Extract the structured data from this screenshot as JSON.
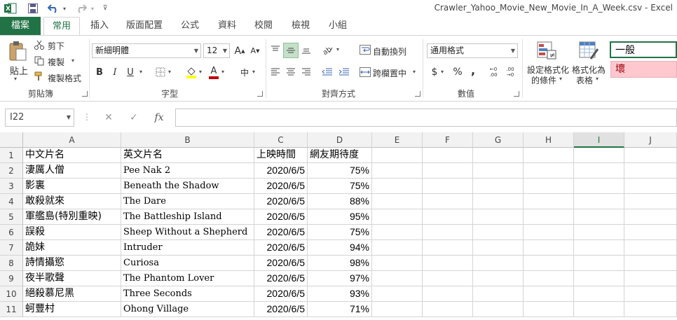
{
  "window": {
    "title": "Crawler_Yahoo_Movie_New_Movie_In_A_Week.csv - Excel"
  },
  "qat": {
    "excel_icon": "excel-logo-icon",
    "save_icon": "save-icon",
    "undo_icon": "undo-icon",
    "redo_icon": "redo-icon",
    "customize_icon": "customize-qat-icon"
  },
  "tabs": {
    "file": "檔案",
    "items": [
      "常用",
      "插入",
      "版面配置",
      "公式",
      "資料",
      "校閱",
      "檢視",
      "小組"
    ]
  },
  "ribbon": {
    "clipboard": {
      "paste": "貼上",
      "cut": "剪下",
      "copy": "複製",
      "format_painter": "複製格式",
      "label": "剪貼簿"
    },
    "font": {
      "name": "新細明體",
      "size": "12",
      "grow": "A",
      "shrink": "A",
      "bold": "B",
      "italic": "I",
      "underline": "U",
      "font_color_letter": "A",
      "phonetic": "中",
      "label": "字型"
    },
    "alignment": {
      "wrap": "自動換列",
      "merge": "跨欄置中",
      "label": "對齊方式"
    },
    "number": {
      "format": "通用格式",
      "currency": "$",
      "percent": "%",
      "comma": ",",
      "inc_decimal": "←0 .00",
      "dec_decimal": ".00 →0",
      "label": "數值"
    },
    "styles": {
      "conditional_line1": "設定格式化",
      "conditional_line2": "的條件",
      "table_line1": "格式化為",
      "table_line2": "表格",
      "normal": "一般",
      "bad": "壞"
    }
  },
  "formula_bar": {
    "name_box": "I22",
    "cancel": "✕",
    "enter": "✓",
    "fx": "fx",
    "value": ""
  },
  "sheet": {
    "columns": [
      "A",
      "B",
      "C",
      "D",
      "E",
      "F",
      "G",
      "H",
      "I",
      "J"
    ],
    "selected_column": "I",
    "row_numbers": [
      "1",
      "2",
      "3",
      "4",
      "5",
      "6",
      "7",
      "8",
      "9",
      "10",
      "11"
    ],
    "rows": [
      [
        "中文片名",
        "英文片名",
        "上映時間",
        "網友期待度"
      ],
      [
        "淒厲人僧",
        "Pee Nak 2",
        "2020/6/5",
        "75%"
      ],
      [
        "影裏",
        "Beneath the Shadow",
        "2020/6/5",
        "75%"
      ],
      [
        "敢殺就來",
        "The Dare",
        "2020/6/5",
        "88%"
      ],
      [
        "軍艦島(特別重映)",
        "The Battleship Island",
        "2020/6/5",
        "95%"
      ],
      [
        "誤殺",
        "Sheep Without a Shepherd",
        "2020/6/5",
        "75%"
      ],
      [
        "詭妹",
        "Intruder",
        "2020/6/5",
        "94%"
      ],
      [
        "詩情攝慾",
        "Curiosa",
        "2020/6/5",
        "98%"
      ],
      [
        "夜半歌聲",
        "The Phantom Lover",
        "2020/6/5",
        "97%"
      ],
      [
        "絕殺慕尼黑",
        "Three Seconds",
        "2020/6/5",
        "93%"
      ],
      [
        "蚵豐村",
        "Ohong Village",
        "2020/6/5",
        "71%"
      ]
    ]
  },
  "colors": {
    "brand": "#217346",
    "bad_fill": "#ffc7ce",
    "bad_text": "#9c0006",
    "font_color": "#c00000",
    "fill_color": "#ffff00"
  }
}
